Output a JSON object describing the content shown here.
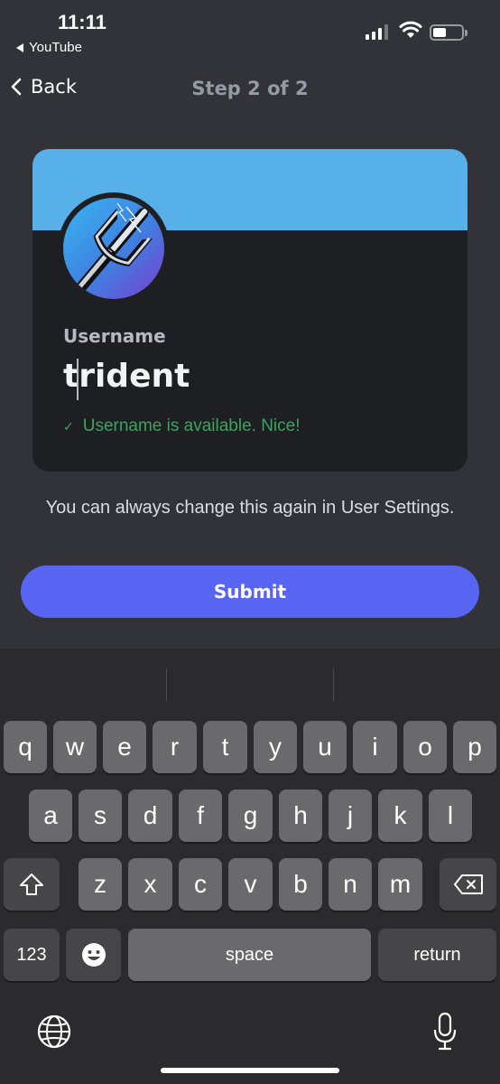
{
  "status_bar": {
    "time": "11:11",
    "back_app": "YouTube"
  },
  "nav": {
    "back_label": "Back",
    "step": "Step 2 of 2"
  },
  "colors": {
    "banner": "#57b0e8",
    "card": "#1e1f22",
    "accent": "#5865f2",
    "success": "#3ba55d",
    "background": "#313338"
  },
  "card": {
    "avatar_icon": "trident-avatar-icon",
    "username_label": "Username",
    "username_value": "trident",
    "availability_check": "✓",
    "availability_text": "Username is available. Nice!"
  },
  "note": "You can always change this again in User Settings.",
  "submit_label": "Submit",
  "keyboard": {
    "row1": [
      "q",
      "w",
      "e",
      "r",
      "t",
      "y",
      "u",
      "i",
      "o",
      "p"
    ],
    "row2": [
      "a",
      "s",
      "d",
      "f",
      "g",
      "h",
      "j",
      "k",
      "l"
    ],
    "row3": [
      "z",
      "x",
      "c",
      "v",
      "b",
      "n",
      "m"
    ],
    "numbers_label": "123",
    "space_label": "space",
    "return_label": "return",
    "icons": [
      "shift-icon",
      "backspace-icon",
      "emoji-icon",
      "globe-icon",
      "microphone-icon"
    ]
  }
}
